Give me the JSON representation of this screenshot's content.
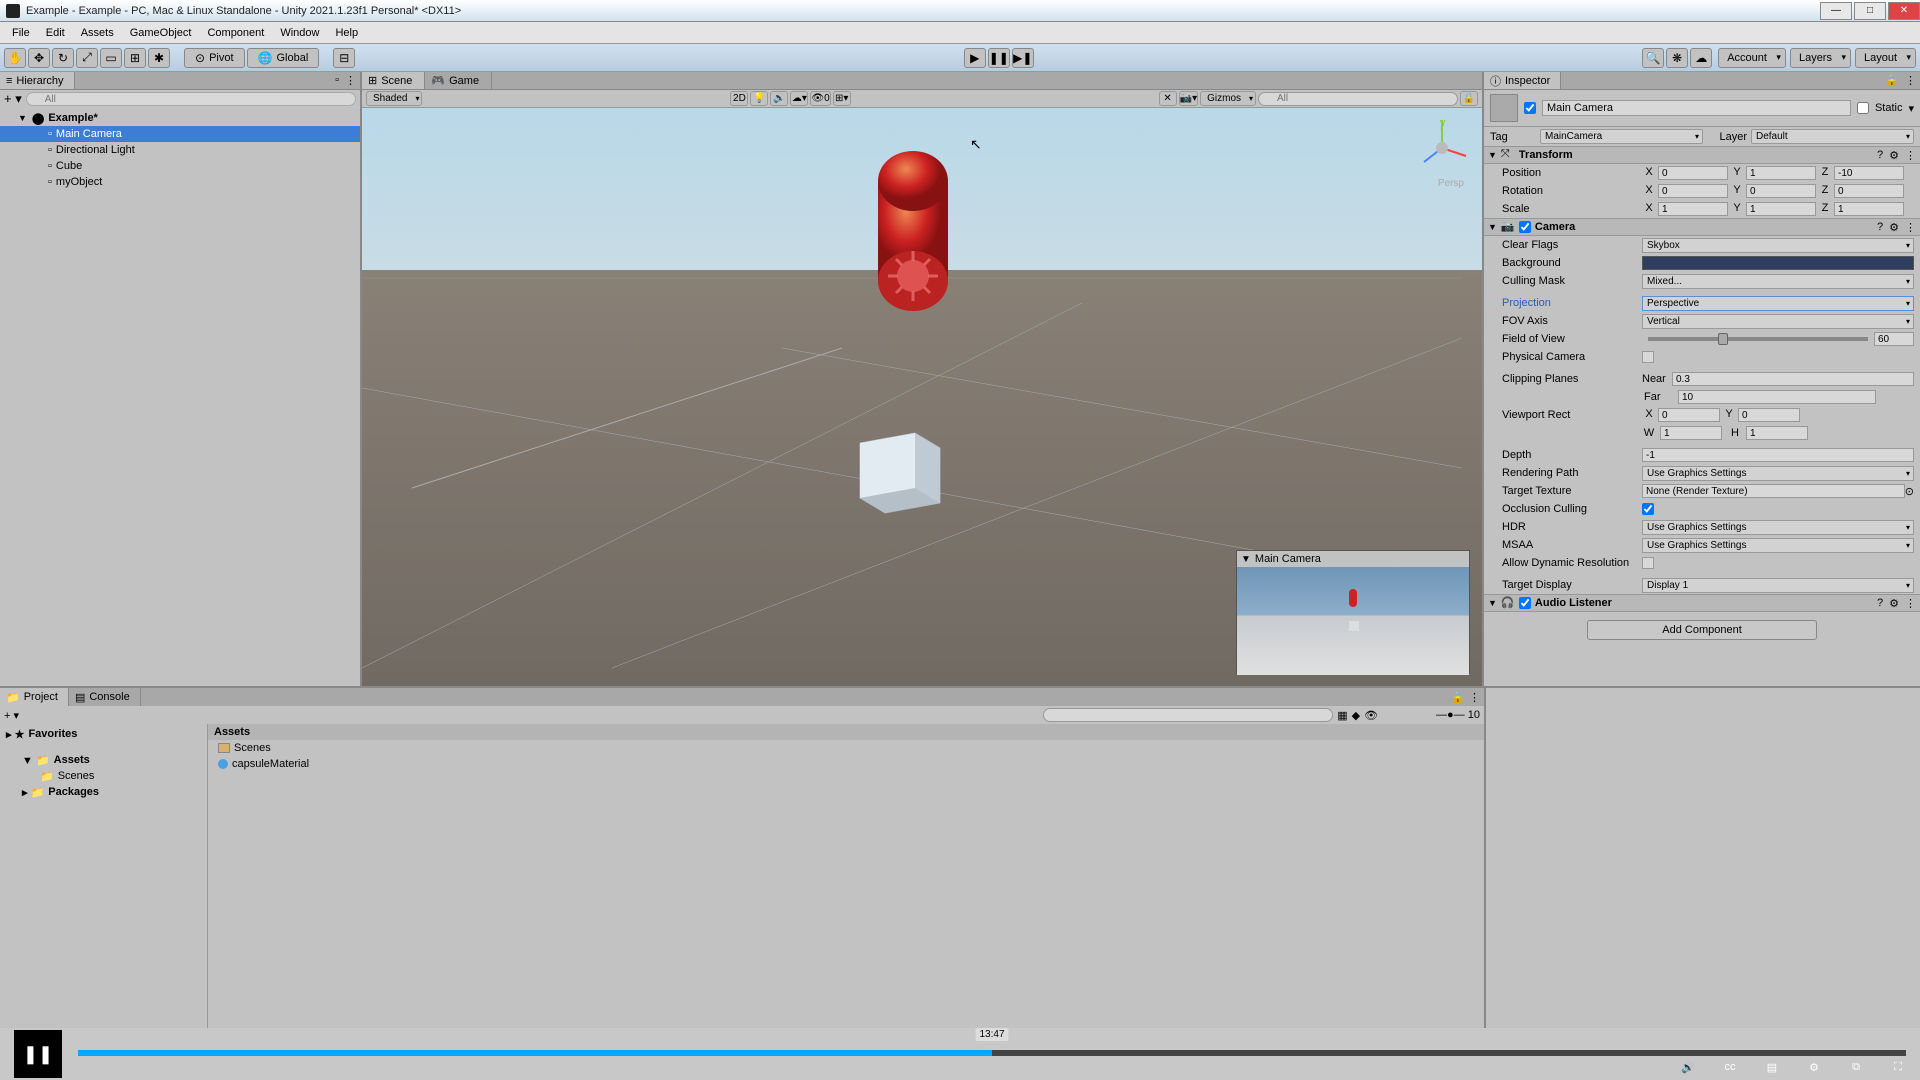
{
  "titlebar": {
    "text": "Example - Example - PC, Mac & Linux Standalone - Unity 2021.1.23f1 Personal* <DX11>"
  },
  "menu": [
    "File",
    "Edit",
    "Assets",
    "GameObject",
    "Component",
    "Window",
    "Help"
  ],
  "toolbar": {
    "pivot": "Pivot",
    "global": "Global",
    "account": "Account",
    "layers": "Layers",
    "layout": "Layout"
  },
  "hierarchy": {
    "title": "Hierarchy",
    "searchPlaceholder": "All",
    "root": "Example*",
    "items": [
      "Main Camera",
      "Directional Light",
      "Cube",
      "myObject"
    ]
  },
  "sceneTabs": {
    "scene": "Scene",
    "game": "Game"
  },
  "sceneToolbar": {
    "shading": "Shaded",
    "twoD": "2D",
    "gizmos": "Gizmos",
    "searchPlaceholder": "All",
    "persp": "Persp"
  },
  "preview": {
    "title": "Main Camera"
  },
  "inspector": {
    "title": "Inspector",
    "objectName": "Main Camera",
    "static": "Static",
    "tagLabel": "Tag",
    "tagValue": "MainCamera",
    "layerLabel": "Layer",
    "layerValue": "Default",
    "transform": {
      "title": "Transform",
      "position": {
        "label": "Position",
        "x": "0",
        "y": "1",
        "z": "-10"
      },
      "rotation": {
        "label": "Rotation",
        "x": "0",
        "y": "0",
        "z": "0"
      },
      "scale": {
        "label": "Scale",
        "x": "1",
        "y": "1",
        "z": "1"
      }
    },
    "camera": {
      "title": "Camera",
      "clearFlags": {
        "label": "Clear Flags",
        "value": "Skybox"
      },
      "background": {
        "label": "Background"
      },
      "cullingMask": {
        "label": "Culling Mask",
        "value": "Mixed..."
      },
      "projection": {
        "label": "Projection",
        "value": "Perspective"
      },
      "fovAxis": {
        "label": "FOV Axis",
        "value": "Vertical"
      },
      "fov": {
        "label": "Field of View",
        "value": "60"
      },
      "physical": {
        "label": "Physical Camera"
      },
      "clipping": {
        "label": "Clipping Planes",
        "near": "Near",
        "nearVal": "0.3",
        "far": "Far",
        "farVal": "10"
      },
      "viewportRect": {
        "label": "Viewport Rect",
        "x": "0",
        "y": "0",
        "w": "1",
        "h": "1"
      },
      "depth": {
        "label": "Depth",
        "value": "-1"
      },
      "renderingPath": {
        "label": "Rendering Path",
        "value": "Use Graphics Settings"
      },
      "targetTexture": {
        "label": "Target Texture",
        "value": "None (Render Texture)"
      },
      "occlusion": {
        "label": "Occlusion Culling"
      },
      "hdr": {
        "label": "HDR",
        "value": "Use Graphics Settings"
      },
      "msaa": {
        "label": "MSAA",
        "value": "Use Graphics Settings"
      },
      "dynamicRes": {
        "label": "Allow Dynamic Resolution"
      },
      "targetDisplay": {
        "label": "Target Display",
        "value": "Display 1"
      }
    },
    "audioListener": {
      "title": "Audio Listener"
    },
    "addComponent": "Add Component"
  },
  "project": {
    "tabProject": "Project",
    "tabConsole": "Console",
    "favorites": "Favorites",
    "assets": "Assets",
    "scenes": "Scenes",
    "packages": "Packages",
    "items": {
      "scenes": "Scenes",
      "capsule": "capsuleMaterial"
    },
    "slider": "10"
  },
  "video": {
    "timestamp": "13:47",
    "progressPct": 50
  }
}
